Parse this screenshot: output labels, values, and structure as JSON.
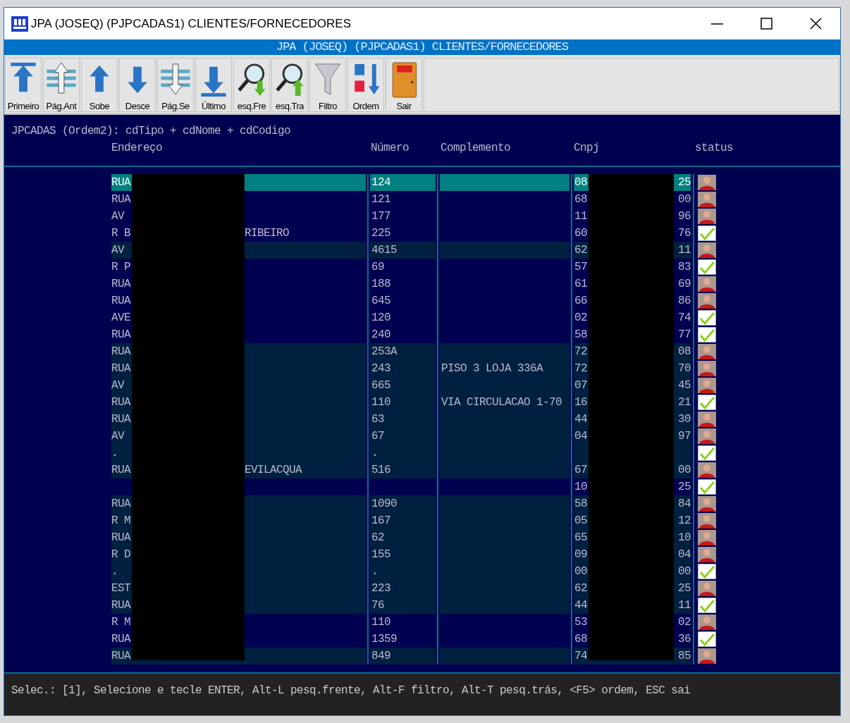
{
  "window": {
    "title": "JPA (JOSEQ) (PJPCADAS1) CLIENTES/FORNECEDORES"
  },
  "banner": "JPA (JOSEQ) (PJPCADAS1) CLIENTES/FORNECEDORES",
  "toolbar": [
    {
      "label": "Primeiro"
    },
    {
      "label": "Pág.Ant"
    },
    {
      "label": "Sobe"
    },
    {
      "label": "Desce"
    },
    {
      "label": "Pág.Se"
    },
    {
      "label": "Último"
    },
    {
      "label": "esq.Fre"
    },
    {
      "label": "esq.Tra"
    },
    {
      "label": "Filtro"
    },
    {
      "label": "Ordem"
    },
    {
      "label": "Sair"
    }
  ],
  "index_line": "JPCADAS (Ordem2): cdTipo + cdNome + cdCodigo",
  "table": {
    "columns": [
      "Endereço",
      "Número",
      "Complemento",
      "Cnpj",
      "status"
    ],
    "rows": [
      {
        "endereco": "RUA",
        "numero": "124",
        "cnpj_start": "08",
        "cnpj_end": "25",
        "kind": "photo",
        "selected": true,
        "highlighted": false
      },
      {
        "endereco": "RUA",
        "numero": "121",
        "cnpj_start": "68",
        "cnpj_end": "00",
        "kind": "photo",
        "selected": false,
        "highlighted": false
      },
      {
        "endereco": "AV",
        "numero": "177",
        "cnpj_start": "11",
        "cnpj_end": "96",
        "kind": "photo",
        "selected": false,
        "highlighted": false
      },
      {
        "endereco": "R B",
        "endereco_end": "RIBEIRO",
        "numero": "225",
        "cnpj_start": "60",
        "cnpj_end": "76",
        "kind": "check",
        "selected": false,
        "highlighted": false
      },
      {
        "endereco": "AV",
        "numero": "4615",
        "cnpj_start": "62",
        "cnpj_end": "11",
        "kind": "photo",
        "selected": false,
        "highlighted": true
      },
      {
        "endereco": "R P",
        "numero": "69",
        "cnpj_start": "57",
        "cnpj_end": "83",
        "kind": "check",
        "selected": false,
        "highlighted": false
      },
      {
        "endereco": "RUA",
        "numero": "188",
        "cnpj_start": "61",
        "cnpj_end": "69",
        "kind": "photo",
        "selected": false,
        "highlighted": false
      },
      {
        "endereco": "RUA",
        "numero": "645",
        "cnpj_start": "66",
        "cnpj_end": "86",
        "kind": "photo",
        "selected": false,
        "highlighted": false
      },
      {
        "endereco": "AVE",
        "numero": "120",
        "cnpj_start": "02",
        "cnpj_end": "74",
        "kind": "check",
        "selected": false,
        "highlighted": false
      },
      {
        "endereco": "RUA",
        "numero": "240",
        "cnpj_start": "58",
        "cnpj_end": "77",
        "kind": "check",
        "selected": false,
        "highlighted": false
      },
      {
        "endereco": "RUA",
        "numero": "253A",
        "cnpj_start": "72",
        "cnpj_end": "08",
        "kind": "photo",
        "selected": false,
        "highlighted": true
      },
      {
        "endereco": "RUA",
        "numero": "243",
        "complemento": "PISO 3 LOJA 336A",
        "cnpj_start": "72",
        "cnpj_end": "70",
        "kind": "photo",
        "selected": false,
        "highlighted": true
      },
      {
        "endereco": "AV",
        "numero": "665",
        "cnpj_start": "07",
        "cnpj_end": "45",
        "kind": "photo",
        "selected": false,
        "highlighted": true
      },
      {
        "endereco": "RUA",
        "numero": "110",
        "complemento": "VIA CIRCULACAO 1-70",
        "cnpj_start": "16",
        "cnpj_end": "21",
        "kind": "check",
        "selected": false,
        "highlighted": true
      },
      {
        "endereco": "RUA",
        "numero": "63",
        "cnpj_start": "44",
        "cnpj_end": "30",
        "kind": "photo",
        "selected": false,
        "highlighted": true
      },
      {
        "endereco": "AV",
        "numero": "67",
        "cnpj_start": "04",
        "cnpj_end": "97",
        "kind": "photo",
        "selected": false,
        "highlighted": true
      },
      {
        "endereco": ".",
        "numero": ".",
        "kind": "check",
        "selected": false,
        "highlighted": true
      },
      {
        "endereco": "RUA",
        "endereco_end": "EVILACQUA",
        "numero": "516",
        "cnpj_start": "67",
        "cnpj_end": "00",
        "kind": "photo",
        "selected": false,
        "highlighted": true
      },
      {
        "cnpj_start": "10",
        "cnpj_end": "25",
        "kind": "check",
        "selected": false,
        "highlighted": false
      },
      {
        "endereco": "RUA",
        "numero": "1090",
        "cnpj_start": "58",
        "cnpj_end": "84",
        "kind": "photo",
        "selected": false,
        "highlighted": true
      },
      {
        "endereco": "R M",
        "numero": "167",
        "cnpj_start": "05",
        "cnpj_end": "12",
        "kind": "photo",
        "selected": false,
        "highlighted": true
      },
      {
        "endereco": "RUA",
        "numero": "62",
        "cnpj_start": "65",
        "cnpj_end": "10",
        "kind": "photo",
        "selected": false,
        "highlighted": true
      },
      {
        "endereco": "R D",
        "numero": "155",
        "cnpj_start": "09",
        "cnpj_end": "04",
        "kind": "photo",
        "selected": false,
        "highlighted": true
      },
      {
        "endereco": ".",
        "numero": ".",
        "cnpj_start": "00",
        "cnpj_end": "00",
        "kind": "check",
        "selected": false,
        "highlighted": true
      },
      {
        "endereco": "EST",
        "numero": "223",
        "cnpj_start": "62",
        "cnpj_end": "25",
        "kind": "photo",
        "selected": false,
        "highlighted": true
      },
      {
        "endereco": "RUA",
        "numero": "76",
        "cnpj_start": "44",
        "cnpj_end": "11",
        "kind": "check",
        "selected": false,
        "highlighted": true
      },
      {
        "endereco": "R M",
        "numero": "110",
        "cnpj_start": "53",
        "cnpj_end": "02",
        "kind": "photo",
        "selected": false,
        "highlighted": false
      },
      {
        "endereco": "RUA",
        "numero": "1359",
        "cnpj_start": "68",
        "cnpj_end": "36",
        "kind": "check",
        "selected": false,
        "highlighted": false
      },
      {
        "endereco": "RUA",
        "numero": "849",
        "cnpj_start": "74",
        "cnpj_end": "85",
        "kind": "photo",
        "selected": false,
        "highlighted": true
      }
    ]
  },
  "status_bar": "Selec.: [1], Selecione e tecle ENTER, Alt-L pesq.frente, Alt-F filtro, Alt-T pesq.trás, <F5> ordem, ESC sai"
}
